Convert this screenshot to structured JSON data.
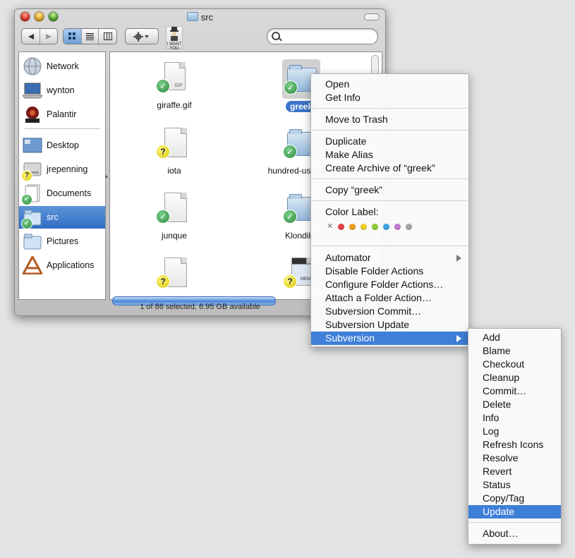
{
  "window": {
    "title": "src",
    "status": "1 of 86 selected, 6.95 GB available"
  },
  "sidebar": {
    "items": [
      {
        "label": "Network",
        "icon": "network-globe-icon",
        "badge": ""
      },
      {
        "label": "wynton",
        "icon": "laptop-icon",
        "badge": ""
      },
      {
        "label": "Palantir",
        "icon": "palantir-orb-icon",
        "badge": ""
      },
      {
        "label": "Desktop",
        "icon": "desktop-icon",
        "badge": ""
      },
      {
        "label": "jrepenning",
        "icon": "home-drive-icon",
        "badge": "?"
      },
      {
        "label": "Documents",
        "icon": "documents-icon",
        "badge": "✓"
      },
      {
        "label": "src",
        "icon": "folder-icon",
        "badge": "✓"
      },
      {
        "label": "Pictures",
        "icon": "pictures-folder-icon",
        "badge": ""
      },
      {
        "label": "Applications",
        "icon": "applications-icon",
        "badge": ""
      }
    ]
  },
  "files": [
    {
      "name": "giraffe.gif",
      "kind": "gif-file-icon",
      "badge": "✓",
      "doc_text": "GIF"
    },
    {
      "name": "greek",
      "kind": "folder-icon",
      "badge": "✓"
    },
    {
      "name": "iota",
      "kind": "document-icon",
      "badge": "?"
    },
    {
      "name": "hundred-user-con",
      "kind": "folder-icon",
      "badge": "✓"
    },
    {
      "name": "junque",
      "kind": "document-icon",
      "badge": "✓"
    },
    {
      "name": "Klondike",
      "kind": "folder-icon",
      "badge": "✓"
    },
    {
      "name": "",
      "kind": "document-icon",
      "badge": "?"
    },
    {
      "name": "",
      "kind": "movie-file-icon",
      "badge": "?",
      "doc_text": "MEME"
    }
  ],
  "context_menu": {
    "items": {
      "open": "Open",
      "get_info": "Get Info",
      "move_to_trash": "Move to Trash",
      "duplicate": "Duplicate",
      "make_alias": "Make Alias",
      "create_archive": "Create Archive of “greek”",
      "copy": "Copy “greek”",
      "color_label": "Color Label:",
      "automator": "Automator",
      "disable_folder_actions": "Disable Folder Actions",
      "configure_folder_actions": "Configure Folder Actions…",
      "attach_folder_action": "Attach a Folder Action…",
      "svn_commit": "Subversion Commit…",
      "svn_update": "Subversion Update",
      "subversion": "Subversion"
    },
    "color_labels": [
      "#e8414a",
      "#f4a21f",
      "#f2d224",
      "#8fd13c",
      "#3fa7e6",
      "#c47ad6",
      "#a8a8a8"
    ]
  },
  "subversion_menu": {
    "items": [
      "Add",
      "Blame",
      "Checkout",
      "Cleanup",
      "Commit…",
      "Delete",
      "Info",
      "Log",
      "Refresh Icons",
      "Resolve",
      "Revert",
      "Status",
      "Copy/Tag",
      "Update"
    ],
    "about": "About…",
    "highlighted": "Update"
  },
  "toolbar": {
    "icon_text": "I WANT YOU"
  }
}
